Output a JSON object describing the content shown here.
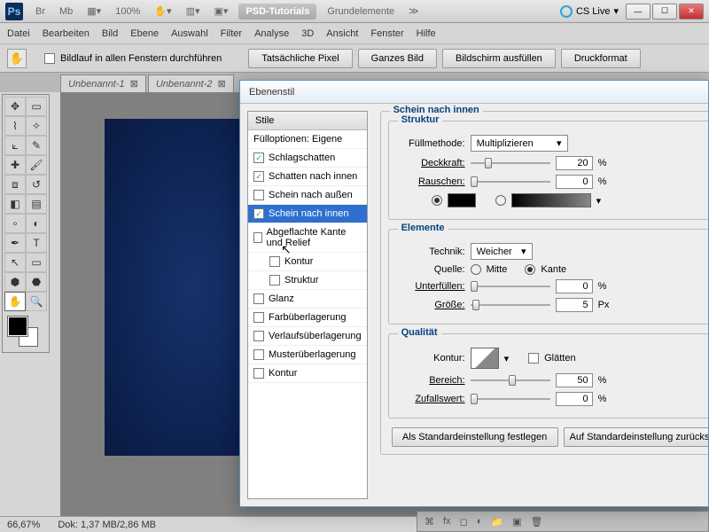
{
  "app": {
    "ps": "Ps",
    "tb_items": [
      "Br",
      "Mb"
    ],
    "zoom": "100%",
    "tabs_accent": "PSD-Tutorials",
    "tabs_gray": "Grundelemente",
    "cslive": "CS Live"
  },
  "menu": [
    "Datei",
    "Bearbeiten",
    "Bild",
    "Ebene",
    "Auswahl",
    "Filter",
    "Analyse",
    "3D",
    "Ansicht",
    "Fenster",
    "Hilfe"
  ],
  "optbar": {
    "scroll_all": "Bildlauf in allen Fenstern durchführen",
    "btns": [
      "Tatsächliche Pixel",
      "Ganzes Bild",
      "Bildschirm ausfüllen",
      "Druckformat"
    ]
  },
  "docs": [
    "Unbenannt-1",
    "Unbenannt-2"
  ],
  "status": {
    "zoom": "66,67%",
    "doc": "Dok: 1,37 MB/2,86 MB"
  },
  "dialog": {
    "title": "Ebenenstil",
    "styles_header": "Stile",
    "blend_header": "Fülloptionen: Eigene",
    "items": [
      {
        "label": "Schlagschatten",
        "on": true
      },
      {
        "label": "Schatten nach innen",
        "on": true
      },
      {
        "label": "Schein nach außen",
        "on": false
      },
      {
        "label": "Schein nach innen",
        "on": true,
        "sel": true
      },
      {
        "label": "Abgeflachte Kante und Relief",
        "on": false
      },
      {
        "label": "Kontur",
        "on": false,
        "indent": true
      },
      {
        "label": "Struktur",
        "on": false,
        "indent": true
      },
      {
        "label": "Glanz",
        "on": false
      },
      {
        "label": "Farbüberlagerung",
        "on": false
      },
      {
        "label": "Verlaufsüberlagerung",
        "on": false
      },
      {
        "label": "Musterüberlagerung",
        "on": false
      },
      {
        "label": "Kontur",
        "on": false
      }
    ],
    "group_title": "Schein nach innen",
    "struktur": {
      "title": "Struktur",
      "fill_label": "Füllmethode:",
      "fill_value": "Multiplizieren",
      "opacity_label": "Deckkraft:",
      "opacity": "20",
      "opacity_unit": "%",
      "noise_label": "Rauschen:",
      "noise": "0",
      "noise_unit": "%"
    },
    "elemente": {
      "title": "Elemente",
      "tech_label": "Technik:",
      "tech_value": "Weicher",
      "source_label": "Quelle:",
      "source_center": "Mitte",
      "source_edge": "Kante",
      "choke_label": "Unterfüllen:",
      "choke": "0",
      "choke_unit": "%",
      "size_label": "Größe:",
      "size": "5",
      "size_unit": "Px"
    },
    "quality": {
      "title": "Qualität",
      "contour_label": "Kontur:",
      "aa": "Glätten",
      "range_label": "Bereich:",
      "range": "50",
      "range_unit": "%",
      "jitter_label": "Zufallswert:",
      "jitter": "0",
      "jitter_unit": "%"
    },
    "defaults_set": "Als Standardeinstellung festlegen",
    "defaults_reset": "Auf Standardeinstellung zurücksetzen"
  }
}
